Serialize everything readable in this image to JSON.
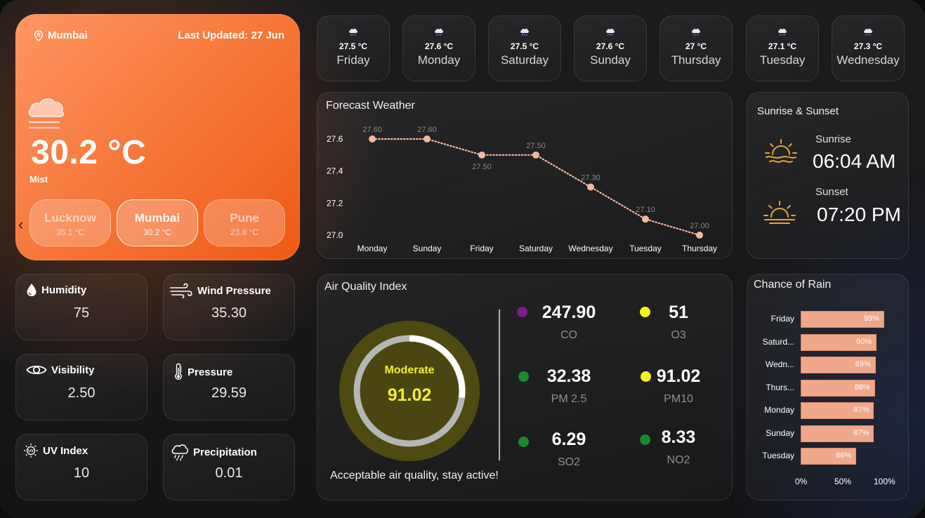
{
  "hero": {
    "location": "Mumbai",
    "last_updated": "Last Updated: 27 Jun",
    "temperature": "30.2 °C",
    "condition": "Mist",
    "icon": "mist-cloud-icon",
    "cities": [
      {
        "name": "Lucknow",
        "temp": "35.1 °C"
      },
      {
        "name": "Mumbai",
        "temp": "30.2 °C"
      },
      {
        "name": "Pune",
        "temp": "23.8 °C"
      }
    ]
  },
  "metrics": {
    "humidity": {
      "label": "Humidity",
      "value": "75"
    },
    "wind": {
      "label": "Wind Pressure",
      "value": "35.30"
    },
    "visibility": {
      "label": "Visibility",
      "value": "2.50"
    },
    "pressure": {
      "label": "Pressure",
      "value": "29.59"
    },
    "uv": {
      "label": "UV Index",
      "value": "10"
    },
    "precipitation": {
      "label": "Precipitation",
      "value": "0.01"
    }
  },
  "days": [
    {
      "temp": "27.5 °C",
      "day": "Friday",
      "icon": "rain-cloud-icon"
    },
    {
      "temp": "27.6 °C",
      "day": "Monday",
      "icon": "rain-cloud-icon"
    },
    {
      "temp": "27.5 °C",
      "day": "Saturday",
      "icon": "rain-cloud-icon"
    },
    {
      "temp": "27.6 °C",
      "day": "Sunday",
      "icon": "rain-cloud-icon"
    },
    {
      "temp": "27 °C",
      "day": "Thursday",
      "icon": "rain-cloud-icon"
    },
    {
      "temp": "27.1 °C",
      "day": "Tuesday",
      "icon": "rain-cloud-icon"
    },
    {
      "temp": "27.3 °C",
      "day": "Wednesday",
      "icon": "rain-cloud-icon"
    }
  ],
  "forecast": {
    "title": "Forecast Weather",
    "chart_data": {
      "type": "line",
      "x": [
        "Monday",
        "Sunday",
        "Friday",
        "Saturday",
        "Wednesday",
        "Tuesday",
        "Thursday"
      ],
      "values": [
        27.6,
        27.6,
        27.5,
        27.5,
        27.3,
        27.1,
        27.0
      ],
      "value_labels": [
        "27.60",
        "27.60",
        "27.50",
        "27.50",
        "27.30",
        "27.10",
        "27.00"
      ],
      "yticks": [
        "27.6",
        "27.4",
        "27.2",
        "27.0"
      ],
      "ylim": [
        27.0,
        27.6
      ],
      "color": "#f2b8a0",
      "line_style": "dotted"
    }
  },
  "sun": {
    "title": "Sunrise & Sunset",
    "sunrise_label": "Sunrise",
    "sunrise": "06:04 AM",
    "sunset_label": "Sunset",
    "sunset": "07:20 PM",
    "icon_color": "#e8a23a"
  },
  "aqi": {
    "title": "Air Quality Index",
    "status": "Moderate",
    "value": "91.02",
    "gauge_fraction": 0.9,
    "message": "Acceptable air quality, stay active!",
    "pollutants": [
      {
        "name": "CO",
        "value": "247.90",
        "color": "#7a1f8c"
      },
      {
        "name": "O3",
        "value": "51",
        "color": "#f4f41c"
      },
      {
        "name": "PM 2.5",
        "value": "32.38",
        "color": "#1a8a2a"
      },
      {
        "name": "PM10",
        "value": "91.02",
        "color": "#f4f41c"
      },
      {
        "name": "SO2",
        "value": "6.29",
        "color": "#1a8a2a"
      },
      {
        "name": "NO2",
        "value": "8.33",
        "color": "#1a8a2a"
      }
    ]
  },
  "rain": {
    "title": "Chance of Rain",
    "chart_data": {
      "type": "bar",
      "orientation": "horizontal",
      "categories": [
        "Friday",
        "Saturd...",
        "Wedn...",
        "Thurs...",
        "Monday",
        "Sunday",
        "Tuesday"
      ],
      "values": [
        99,
        90,
        89,
        88,
        87,
        87,
        66
      ],
      "labels": [
        "99%",
        "90%",
        "89%",
        "88%",
        "87%",
        "87%",
        "66%"
      ],
      "xticks": [
        "0%",
        "50%",
        "100%"
      ],
      "xlim": [
        0,
        100
      ],
      "color": "#f0a78a"
    }
  }
}
